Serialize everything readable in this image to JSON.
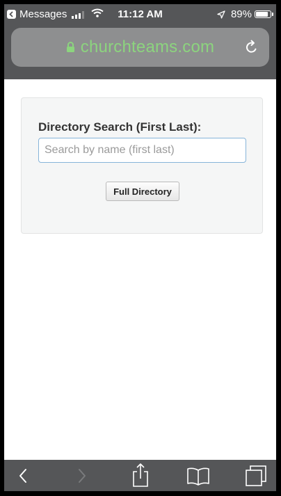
{
  "status_bar": {
    "back_app": "Messages",
    "time": "11:12 AM",
    "battery": "89%",
    "battery_level": 0.89
  },
  "url_bar": {
    "domain": "churchteams.com",
    "domain_color": "#8cd47e"
  },
  "directory": {
    "label": "Directory Search (First Last):",
    "search_placeholder": "Search by name (first last)",
    "search_value": "",
    "full_directory_label": "Full Directory"
  },
  "toolbar": {
    "icons": [
      "back-icon",
      "forward-icon",
      "share-icon",
      "bookmarks-icon",
      "tabs-icon"
    ]
  },
  "colors": {
    "chrome": "#555658",
    "url_bar_bg": "#8e8f90",
    "panel_bg": "#f5f6f6",
    "input_border": "#86b4d9"
  }
}
